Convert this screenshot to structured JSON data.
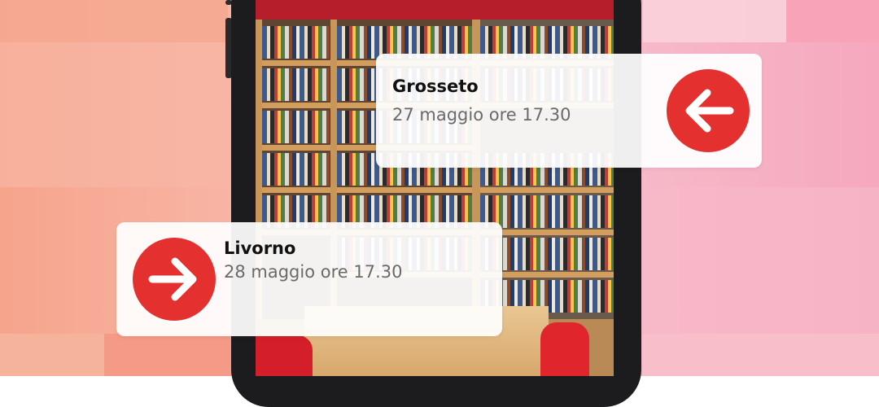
{
  "events": [
    {
      "city": "Grosseto",
      "when": "27 maggio ore 17.30",
      "arrow": "arrow-left-icon"
    },
    {
      "city": "Livorno",
      "when": "28 maggio ore 17.30",
      "arrow": "arrow-right-icon"
    }
  ],
  "colors": {
    "accent": "#e4302e",
    "background_left": "#f6a48c",
    "background_right": "#f6a8be"
  }
}
